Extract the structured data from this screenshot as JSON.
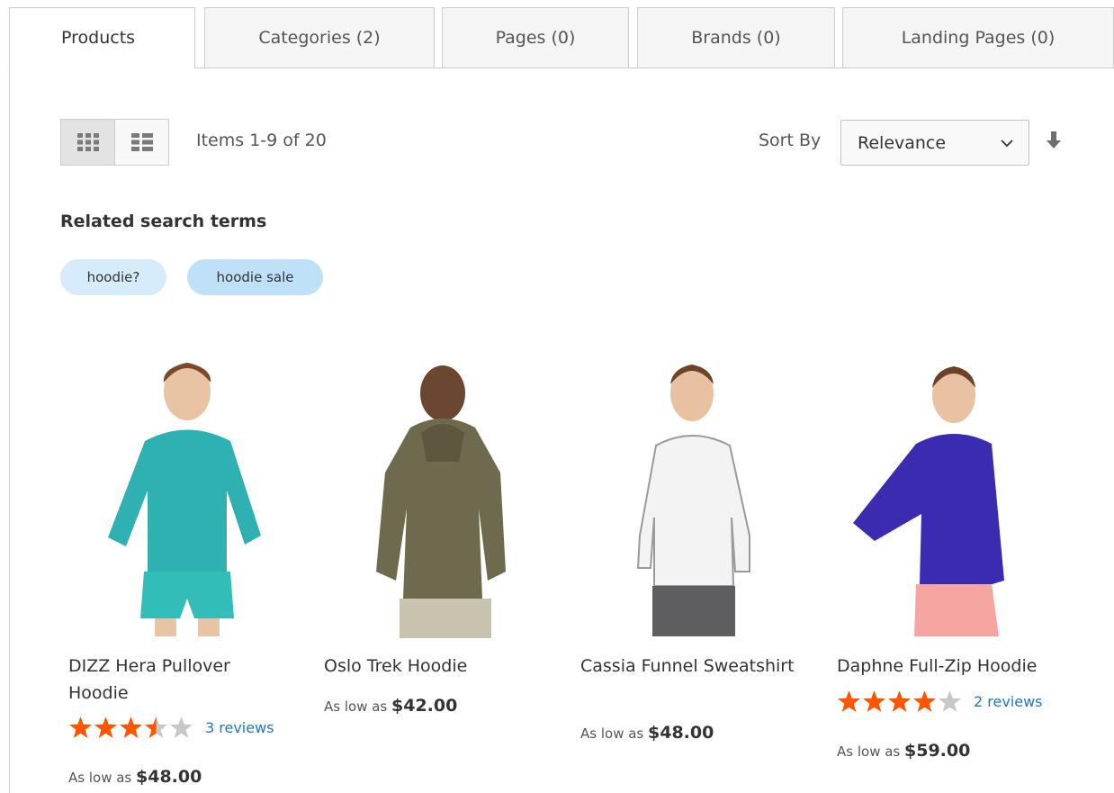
{
  "tabs": [
    {
      "label": "Products",
      "active": true
    },
    {
      "label": "Categories (2)"
    },
    {
      "label": "Pages (0)"
    },
    {
      "label": "Brands (0)"
    },
    {
      "label": "Landing Pages (0)"
    }
  ],
  "toolbar": {
    "view_modes": [
      "grid-view-icon",
      "list-view-icon"
    ],
    "active_mode": "grid",
    "items_count": "Items 1-9 of 20",
    "sort_label": "Sort By",
    "sort_value": "Relevance",
    "sort_direction_icon": "arrow-down-icon"
  },
  "related": {
    "title": "Related search terms",
    "terms": [
      "hoodie?",
      "hoodie sale"
    ]
  },
  "colors": {
    "star_filled": "#ff5501",
    "star_empty": "#c8c8c8",
    "link": "#1979c3",
    "chip": "#d6ecfa"
  },
  "products": [
    {
      "name": "DIZZ Hera Pullover Hoodie",
      "rating": 3.5,
      "reviews": "3 reviews",
      "price_prefix": "As low as",
      "price": "$48.00"
    },
    {
      "name": "Oslo Trek Hoodie",
      "price_prefix": "As low as",
      "price": "$42.00"
    },
    {
      "name": "Cassia Funnel Sweatshirt",
      "price_prefix": "As low as",
      "price": "$48.00"
    },
    {
      "name": "Daphne Full-Zip Hoodie",
      "rating": 4,
      "reviews": "2 reviews",
      "price_prefix": "As low as",
      "price": "$59.00"
    }
  ]
}
